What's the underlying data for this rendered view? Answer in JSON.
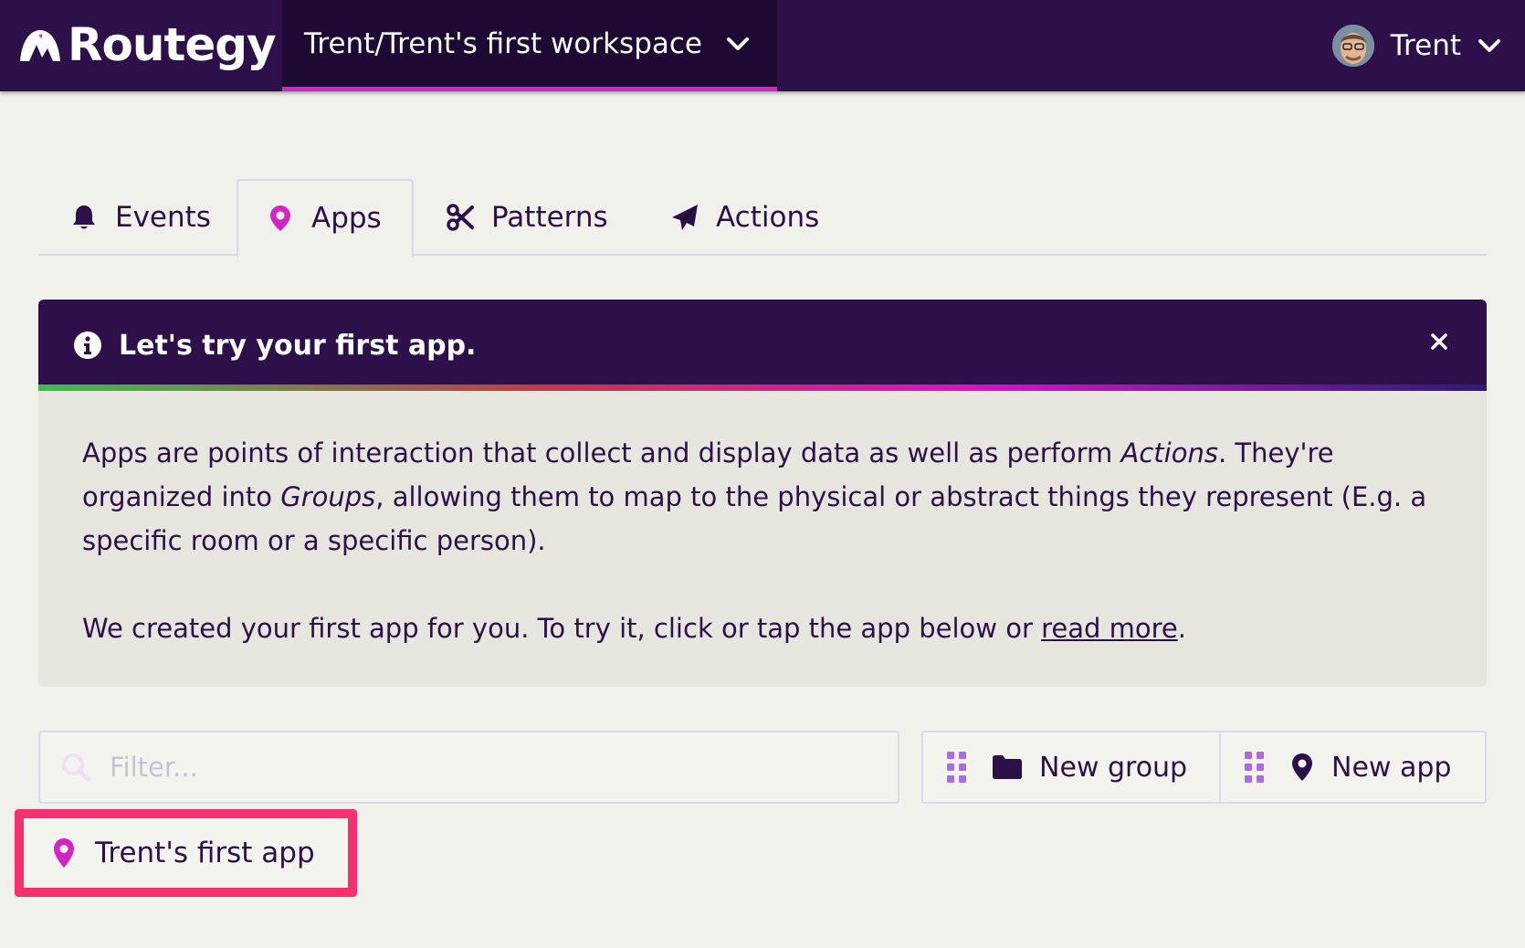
{
  "header": {
    "logo_text": "Routegy",
    "workspace_label": "Trent/Trent's first workspace",
    "user_name": "Trent"
  },
  "tabs": [
    {
      "label": "Events",
      "icon": "bell-icon",
      "active": false
    },
    {
      "label": "Apps",
      "icon": "map-pin-icon",
      "active": true
    },
    {
      "label": "Patterns",
      "icon": "scissors-icon",
      "active": false
    },
    {
      "label": "Actions",
      "icon": "paper-plane-icon",
      "active": false
    }
  ],
  "banner": {
    "title": "Let's try your first app.",
    "para1": {
      "t1": "Apps are points of interaction that collect and display data as well as perform ",
      "em1": "Actions",
      "t2": ". They're organized into ",
      "em2": "Groups",
      "t3": ", allowing them to map to the physical or abstract things they represent (E.g. a specific room or a specific person)."
    },
    "para2": {
      "t1": "We created your first app for you. To try it, click or tap the app below or ",
      "link": "read more",
      "t2": "."
    }
  },
  "filter": {
    "placeholder": "Filter...",
    "value": ""
  },
  "buttons": {
    "new_group": "New group",
    "new_app": "New app"
  },
  "apps": [
    {
      "label": "Trent's first app"
    }
  ],
  "colors": {
    "header_bg": "#2d0f49",
    "accent_magenta": "#d026c6",
    "highlight_pink": "#f5306e",
    "page_bg": "#f1f1ec"
  }
}
